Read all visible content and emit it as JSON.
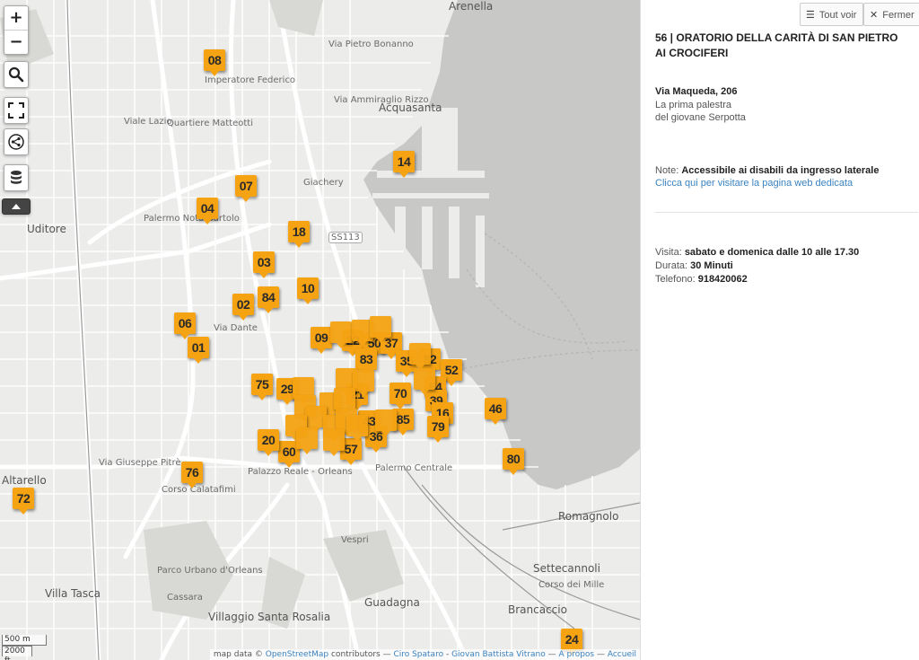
{
  "map": {
    "zoom_in": "+",
    "zoom_out": "−",
    "controls": [
      "search-icon",
      "fullscreen-icon",
      "share-icon",
      "layers-icon",
      "collapse-icon"
    ],
    "labels": [
      "Arenella",
      "Acquasanta",
      "Uditore",
      "Altarello",
      "Villa Tasca",
      "Romagnolo",
      "Settecannoli",
      "Brancaccio",
      "Guadagna",
      "Villaggio Santa Rosalia",
      "Parco Urbano d'Orleans",
      "Imperatore Federico",
      "Quartiere Matteotti",
      "Palermo Notarbartolo",
      "Palermo Centrale",
      "Palazzo Reale - Orleans",
      "Via Giuseppe Pitrè",
      "Corso Calatafimi",
      "Viale Lazio",
      "Via Dante",
      "Via Pietro Bonanno",
      "Via Ammiraglio Rizzo",
      "Corso dei Mille",
      "Vespri",
      "Cassara",
      "SS113",
      "Giachery"
    ],
    "markers": [
      {
        "num": "08"
      },
      {
        "num": "14"
      },
      {
        "num": "07"
      },
      {
        "num": "04"
      },
      {
        "num": "18"
      },
      {
        "num": "03"
      },
      {
        "num": "84"
      },
      {
        "num": "02"
      },
      {
        "num": "10"
      },
      {
        "num": "06"
      },
      {
        "num": "01"
      },
      {
        "num": "09"
      },
      {
        "num": "22"
      },
      {
        "num": "50"
      },
      {
        "num": "37"
      },
      {
        "num": "83"
      },
      {
        "num": "35"
      },
      {
        "num": "82"
      },
      {
        "num": "52"
      },
      {
        "num": "75"
      },
      {
        "num": "29"
      },
      {
        "num": "21"
      },
      {
        "num": "70"
      },
      {
        "num": "54"
      },
      {
        "num": "39"
      },
      {
        "num": "46"
      },
      {
        "num": "16"
      },
      {
        "num": "85"
      },
      {
        "num": "79"
      },
      {
        "num": "43"
      },
      {
        "num": "36"
      },
      {
        "num": "57"
      },
      {
        "num": "60"
      },
      {
        "num": "20"
      },
      {
        "num": "80"
      },
      {
        "num": "76"
      },
      {
        "num": "72"
      },
      {
        "num": "24"
      }
    ],
    "scale_metric": "500 m",
    "scale_imperial": "2000 ft",
    "attribution": {
      "prefix": "map data © ",
      "osm": "OpenStreetMap",
      "contributors": " contributors — ",
      "author1": "Ciro Spataro",
      "sep": " - ",
      "author2": "Giovan Battista Vitrano",
      "tail": " — ",
      "about": "A propos",
      "sep2": " — ",
      "home": "Accueil"
    }
  },
  "panel": {
    "btn_show_all": "Tout voir",
    "btn_close": "Fermer",
    "title": "56 | ORATORIO DELLA CARITÀ DI SAN PIETRO AI CROCIFERI",
    "address": "Via Maqueda, 206",
    "desc_line1": "La prima palestra",
    "desc_line2": "del giovane Serpotta",
    "note_label": "Note: ",
    "note_value": "Accessibile ai disabili da ingresso laterale",
    "link": "Clicca qui per visitare la pagina web dedicata",
    "visit_label": "Visita: ",
    "visit_value": "sabato e domenica dalle 10 alle 17.30",
    "duration_label": "Durata: ",
    "duration_value": "30 Minuti",
    "phone_label": "Telefono: ",
    "phone_value": "918420062"
  }
}
